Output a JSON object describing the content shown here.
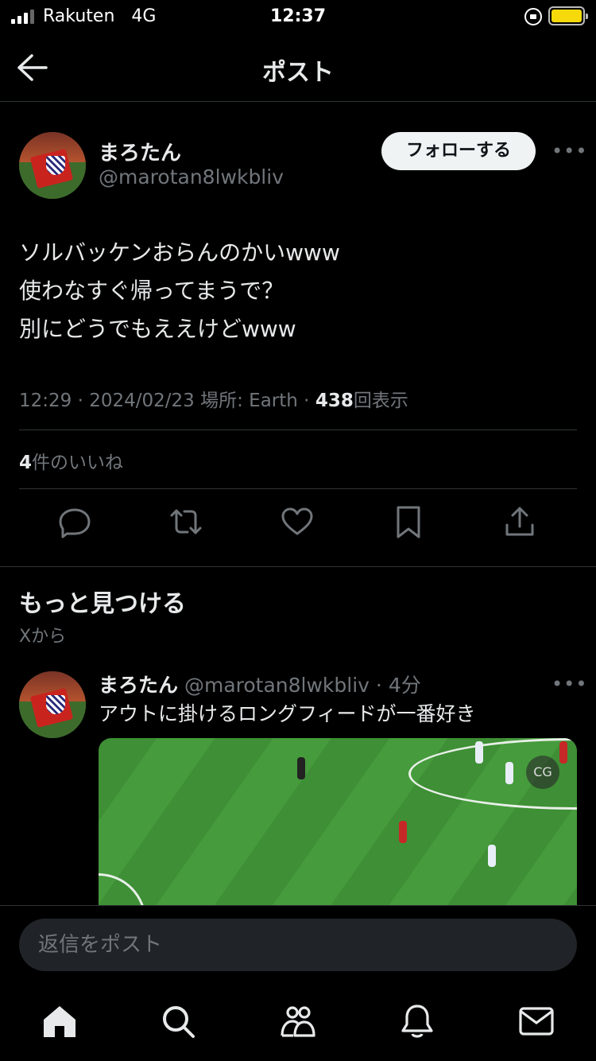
{
  "status_bar": {
    "carrier": "Rakuten",
    "network": "4G",
    "time": "12:37",
    "battery_color": "#f5d90a"
  },
  "header": {
    "title": "ポスト"
  },
  "post": {
    "author_name": "まろたん",
    "author_handle": "@marotan8lwkbliv",
    "follow_label": "フォローする",
    "more_label": "•••",
    "body_lines": [
      "ソルバッケンおらんのかいwww",
      "使わなすぐ帰ってまうで？",
      "別にどうでもええけどwww"
    ],
    "time": "12:29",
    "date": "2024/02/23",
    "location": "場所: Earth",
    "view_count": "438",
    "view_label": "回表示",
    "like_count": "4",
    "like_label": "件のいいね"
  },
  "discover": {
    "title": "もっと見つける",
    "subtitle": "Xから",
    "item": {
      "author_name": "まろたん",
      "author_handle": "@marotan8lwkbliv",
      "age": "4分",
      "text": "アウトに掛けるロングフィードが一番好き",
      "media_badge": "CG"
    }
  },
  "reply": {
    "placeholder": "返信をポスト"
  }
}
